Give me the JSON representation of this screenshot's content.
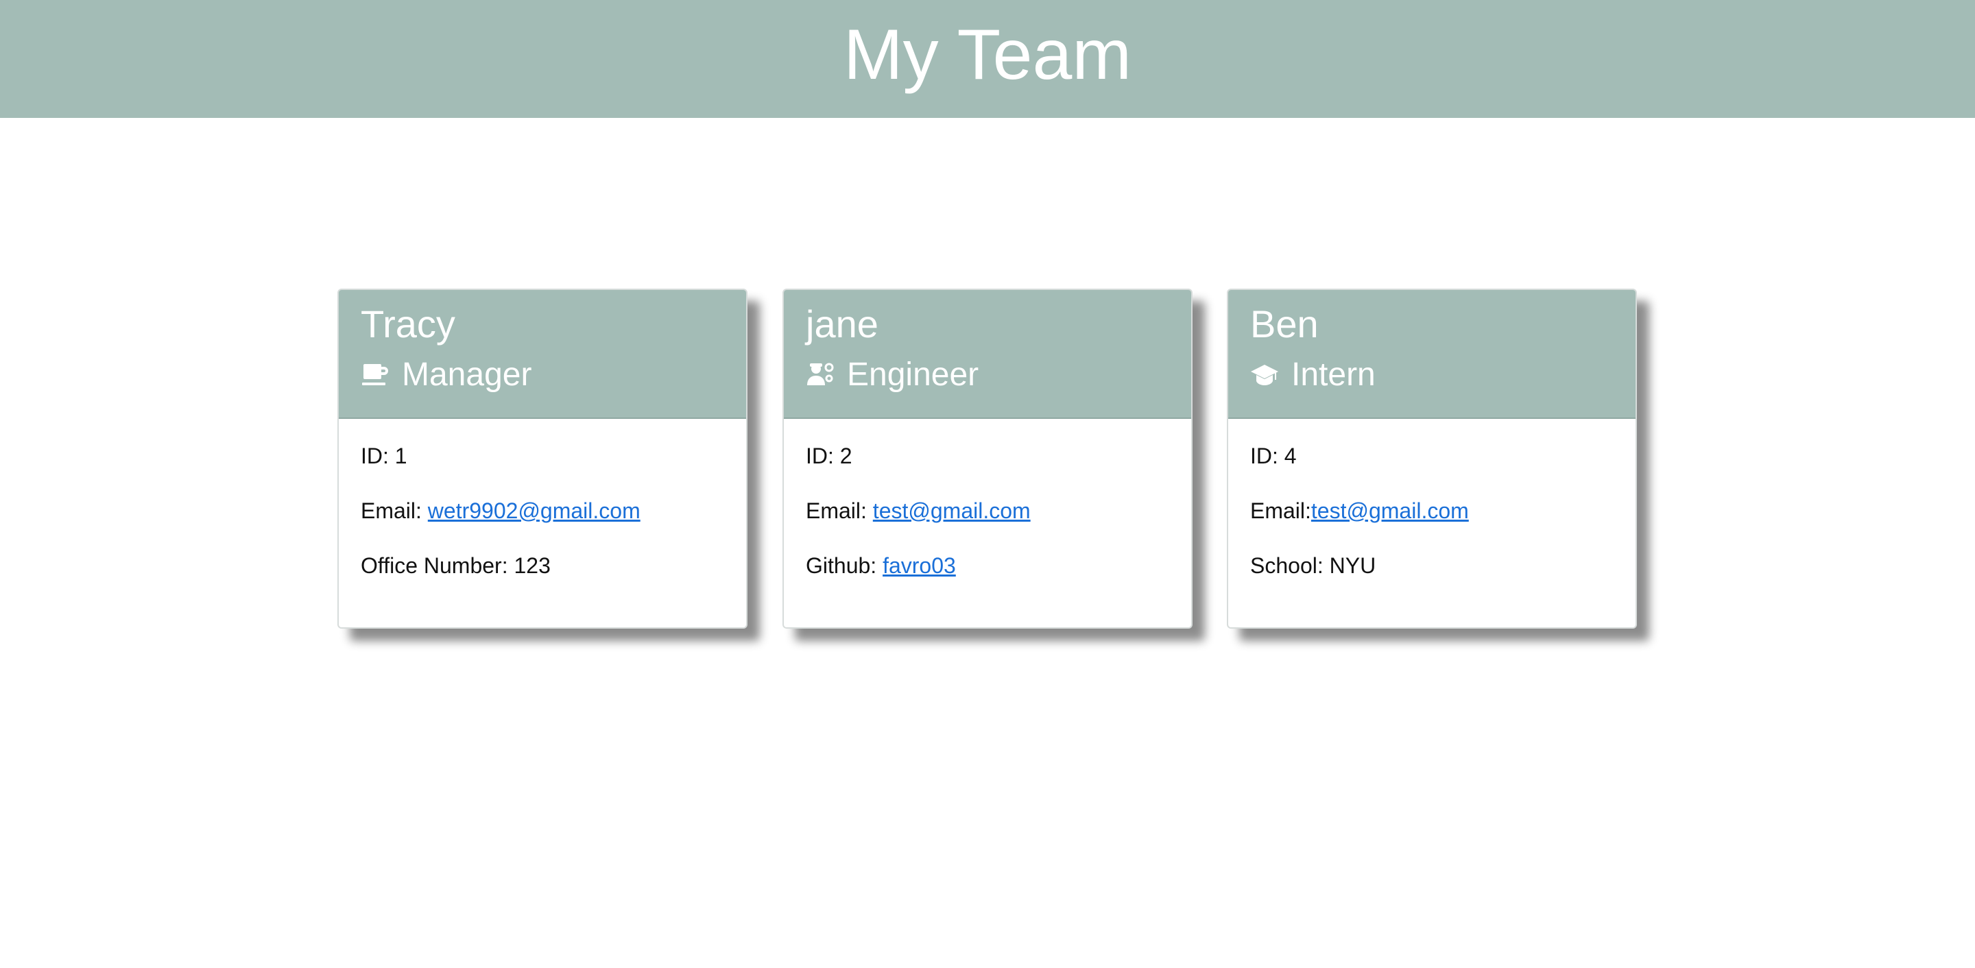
{
  "header": {
    "title": "My Team"
  },
  "cards": [
    {
      "name": "Tracy",
      "role": "Manager",
      "icon": "coffee-mug-icon",
      "id_label": "ID: ",
      "id": "1",
      "email_label": "Email: ",
      "email": "wetr9902@gmail.com",
      "extra_label": "Office Number: ",
      "extra_value": "123"
    },
    {
      "name": "jane",
      "role": "Engineer",
      "icon": "user-gears-icon",
      "id_label": "ID: ",
      "id": "2",
      "email_label": "Email: ",
      "email": "test@gmail.com",
      "extra_label": "Github: ",
      "extra_value": "favro03"
    },
    {
      "name": "Ben",
      "role": "Intern",
      "icon": "graduation-cap-icon",
      "id_label": "ID: ",
      "id": "4",
      "email_label": "Email:",
      "email": "test@gmail.com",
      "extra_label": "School: ",
      "extra_value": "NYU"
    }
  ],
  "colors": {
    "header_bg": "#a3bcb6",
    "link": "#1a6fd8"
  }
}
